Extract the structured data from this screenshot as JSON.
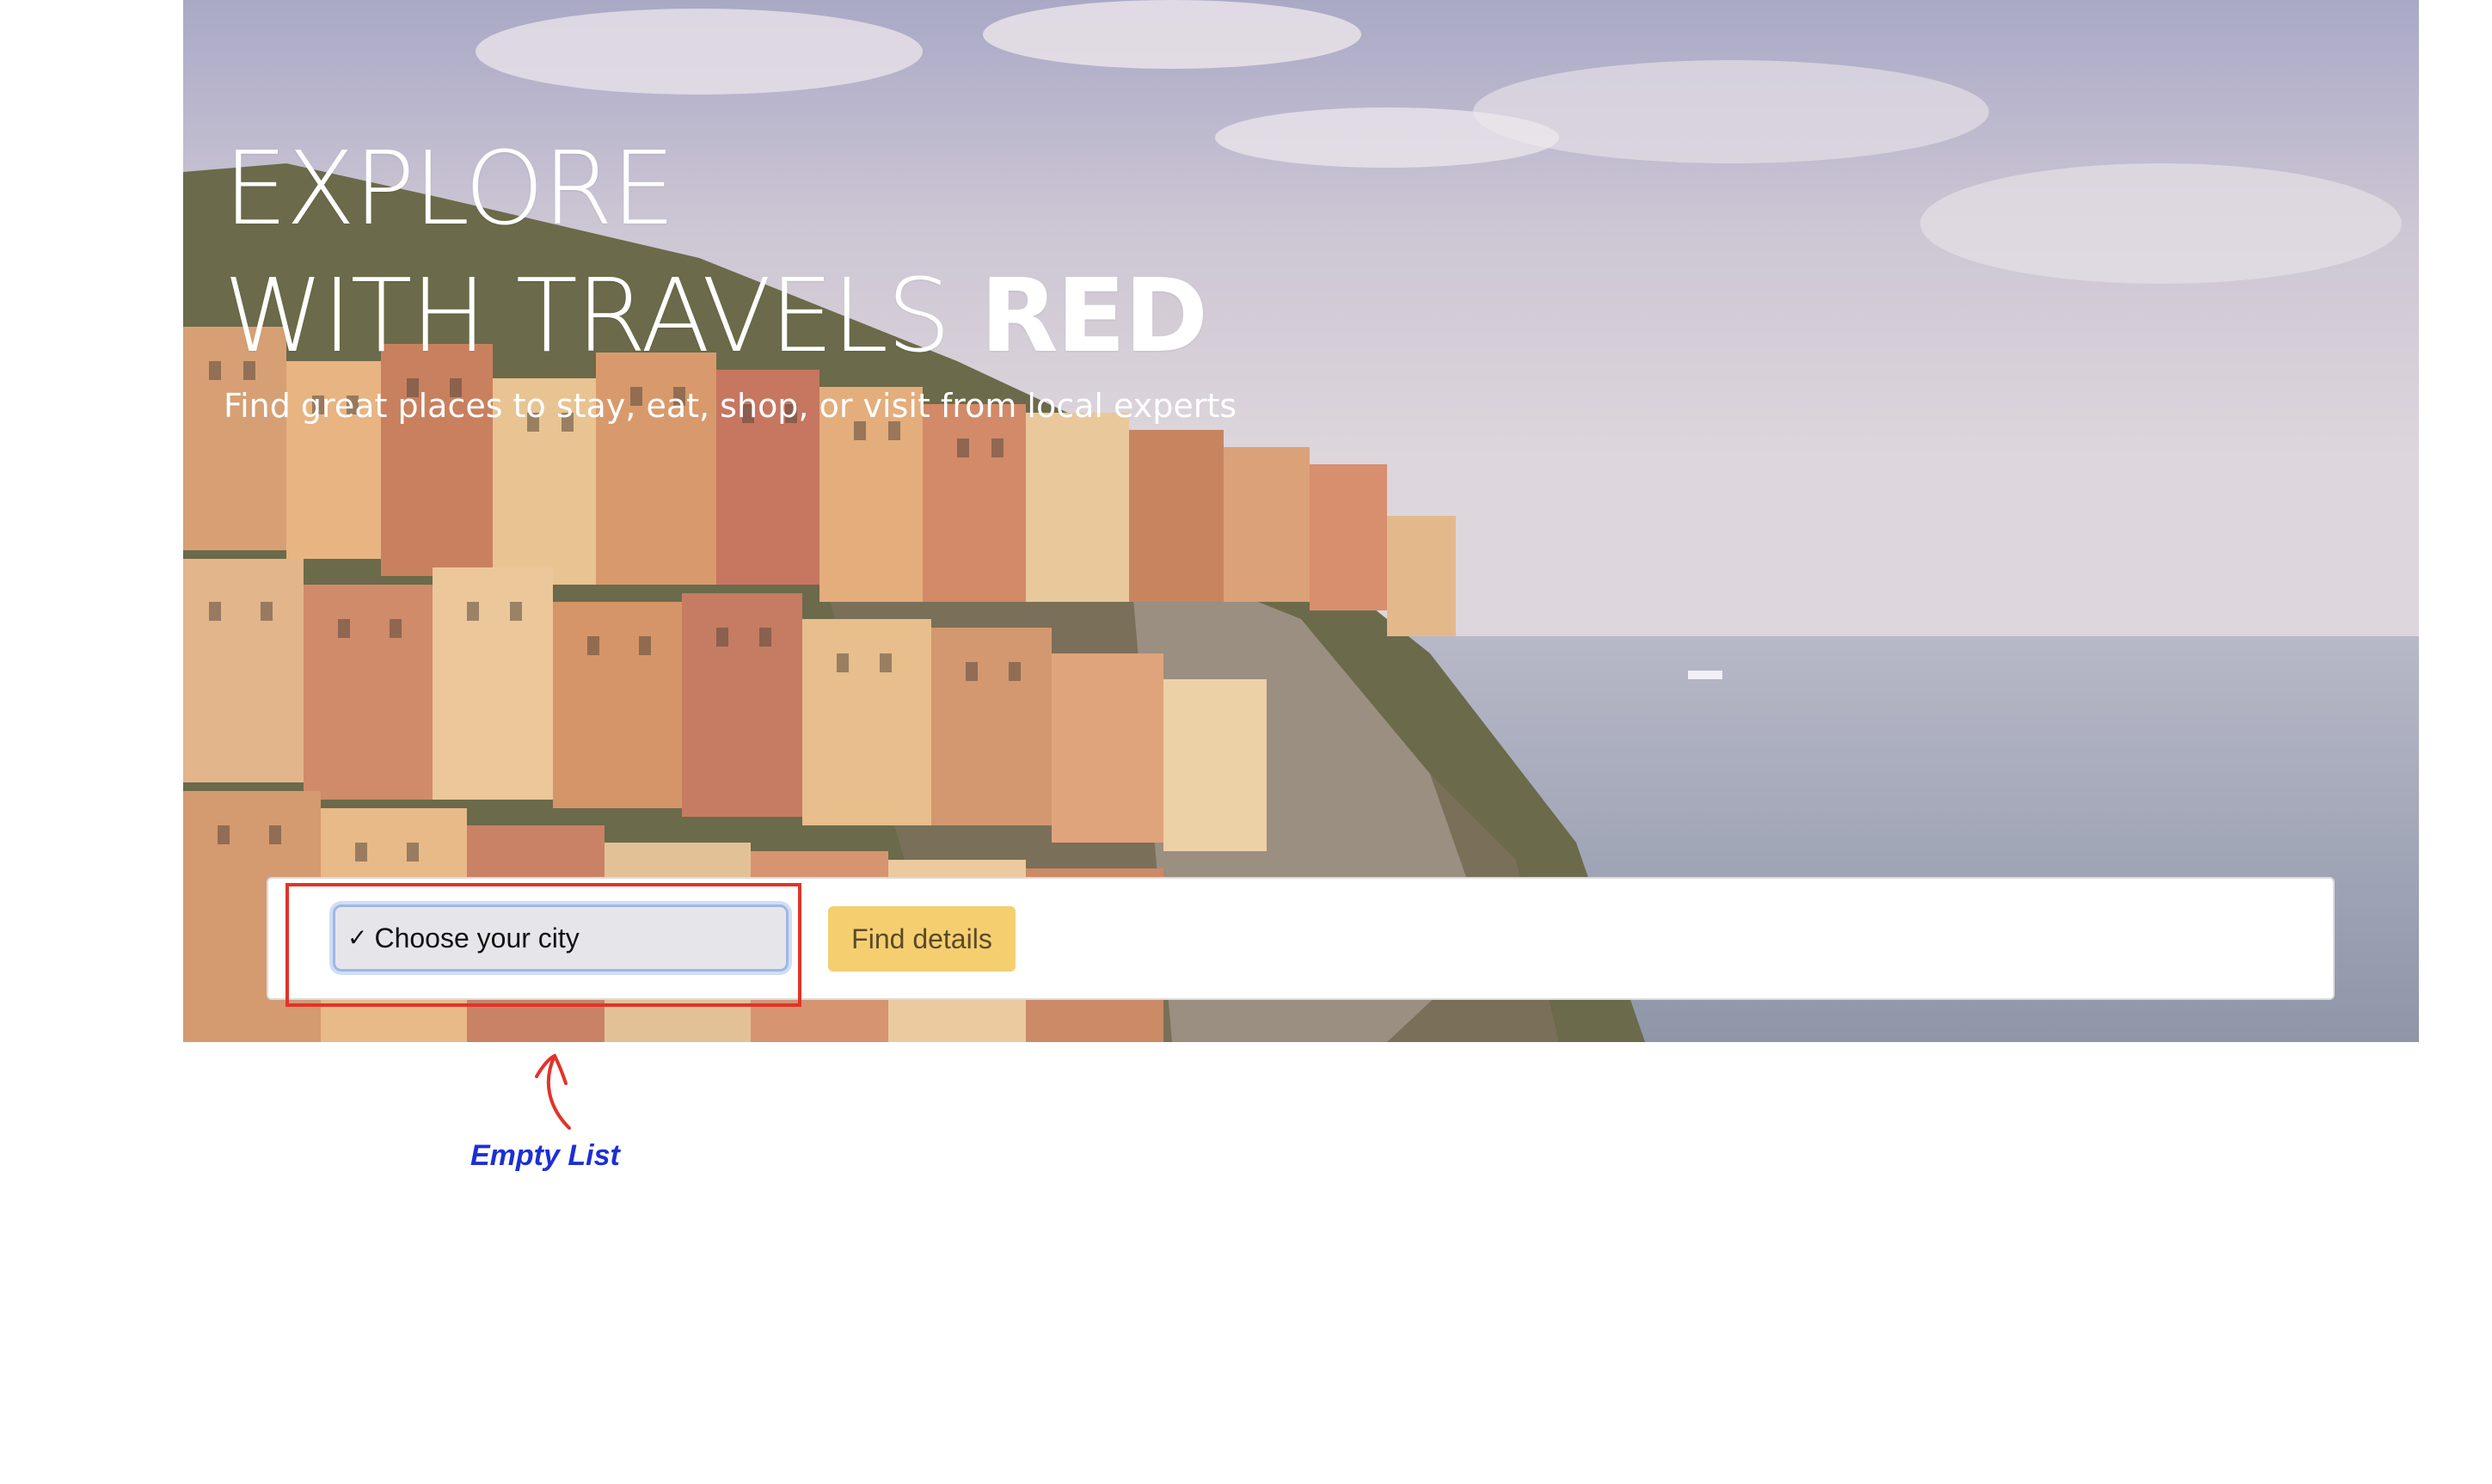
{
  "hero": {
    "title_line1": "EXPLORE",
    "title_line2_prefix": "WITH TRAVELS ",
    "title_line2_accent": "RED",
    "subtitle": "Find great places to stay, eat, shop, or visit from local experts"
  },
  "search": {
    "city_select": {
      "selected_label": "Choose your city",
      "check_icon": "✓"
    },
    "find_button_label": "Find details"
  },
  "annotation": {
    "label": "Empty List",
    "box_color": "#e2332a",
    "text_color": "#1d2fd4"
  },
  "colors": {
    "button_bg": "#f5cf6f",
    "select_bg": "#e6e6ea"
  }
}
